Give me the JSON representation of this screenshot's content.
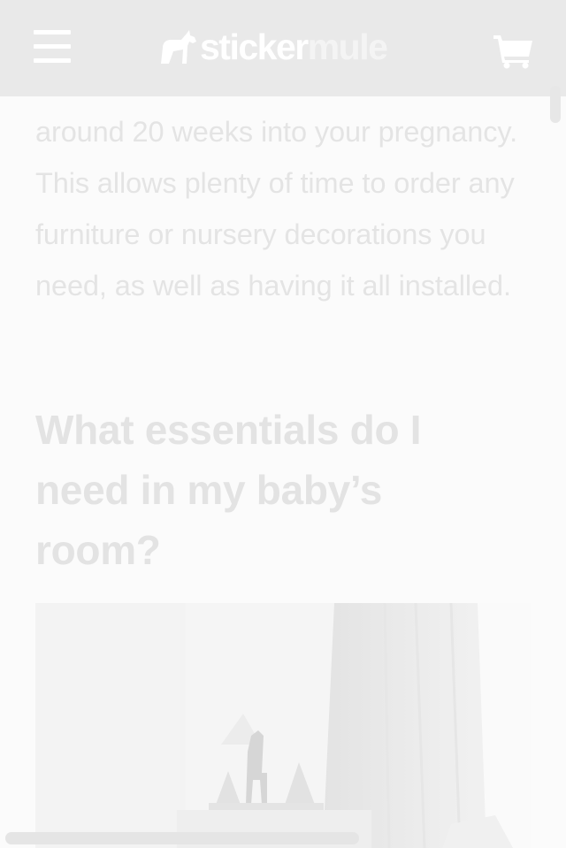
{
  "header": {
    "logo_part1": "sticker",
    "logo_part2": "mule"
  },
  "article": {
    "intro_paragraph": "around 20 weeks into your pregnancy. This allows plenty of time to order any furniture or nursery decorations you need, as well as having it all installed.",
    "section_heading": "What essentials do I need in my baby’s room?"
  },
  "colors": {
    "header_bg": "#e9e9e9",
    "page_bg": "#fbfbfb",
    "text": "#e4e4e4"
  },
  "icons": [
    "menu-icon",
    "horse-logo-icon",
    "cart-icon"
  ]
}
